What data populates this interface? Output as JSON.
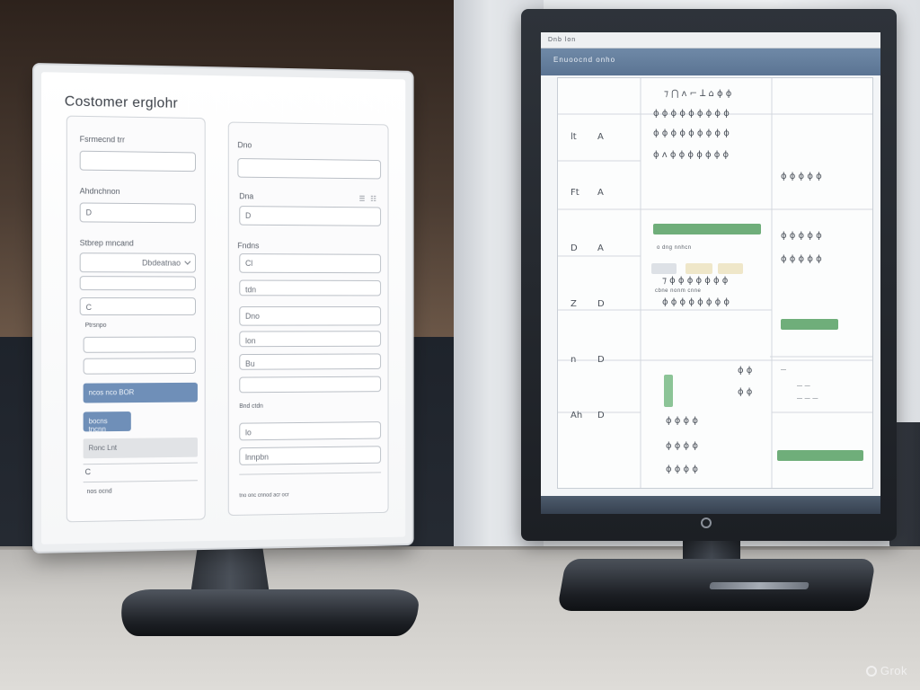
{
  "watermark": "Grok",
  "left_form": {
    "title": "Costomer erglohr",
    "col_a": {
      "label_1": "Fsrmecnd trr",
      "label_2": "Ahdnchnon",
      "field_2_value": "D",
      "label_3": "Stbrep mncand",
      "field_3_value": "Dbdeatnao",
      "field_5_value": "C",
      "label_4": "Ptrsnpo",
      "button_primary": "ncos nco BOR",
      "button_secondary": "bocns tncnn",
      "grey_row": "Ronc Lnt",
      "field_last_value": "C",
      "footer_text": "nos ocnd"
    },
    "col_b": {
      "label_1": "Dno",
      "label_2": "Dna",
      "field_2_value": "D",
      "label_3": "Fndns",
      "field_3_value": "Cl",
      "field_4_value": "tdn",
      "field_5_value": "Dno",
      "field_6_value": "lon",
      "field_7_value": "Bu",
      "label_4": "Bnd ctdn",
      "field_9_value": "lo",
      "field_10_value": "lnnpbn",
      "footer_text": "tno onc cnnod acr ocr"
    }
  },
  "right_app": {
    "topbar": "Dnb lon",
    "header": "Enuoocnd onho",
    "row_labels": [
      "lt",
      "A",
      "Ft",
      "A",
      "D",
      "A",
      "Z",
      "D",
      "n",
      "D",
      "Ah",
      "D"
    ],
    "status_text": "cbne nonm cnne",
    "legend_text": "o dng nnhcn"
  },
  "colors": {
    "accent_blue": "#6f8fb8",
    "header_blue": "#5b7493",
    "success_green": "#6fae7a"
  }
}
